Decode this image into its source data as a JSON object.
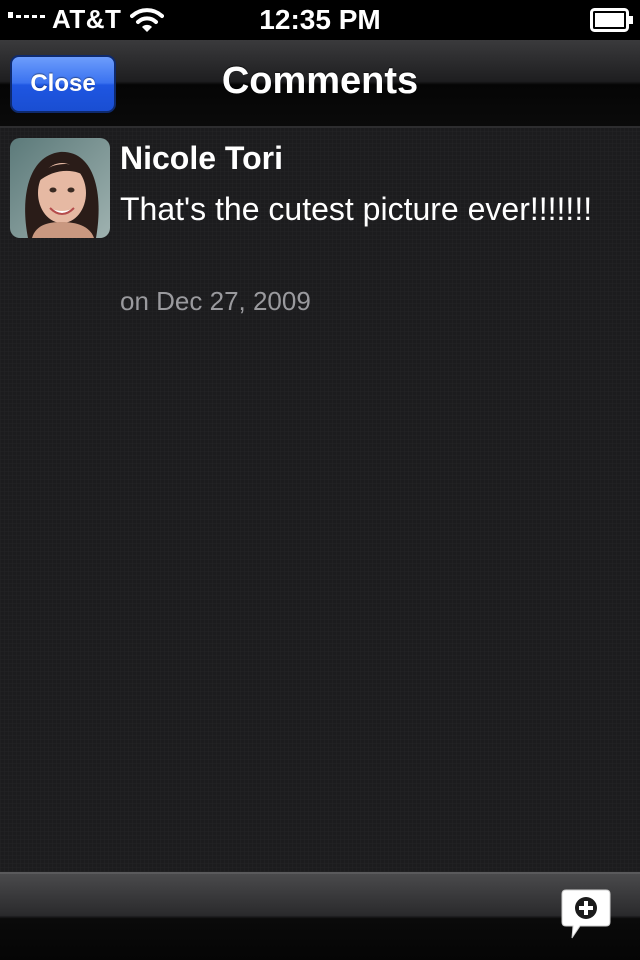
{
  "status_bar": {
    "carrier": "AT&T",
    "time": "12:35 PM"
  },
  "nav": {
    "title": "Comments",
    "close_label": "Close"
  },
  "comments": [
    {
      "author": "Nicole Tori",
      "text": "That's the cutest picture ever!!!!!!!",
      "date": "on Dec 27, 2009"
    }
  ],
  "toolbar": {
    "add_comment_icon": "add-comment-bubble-icon"
  },
  "colors": {
    "background": "#1c1c1e",
    "button_blue": "#2f67ea",
    "date_gray": "#9a9a9e"
  }
}
